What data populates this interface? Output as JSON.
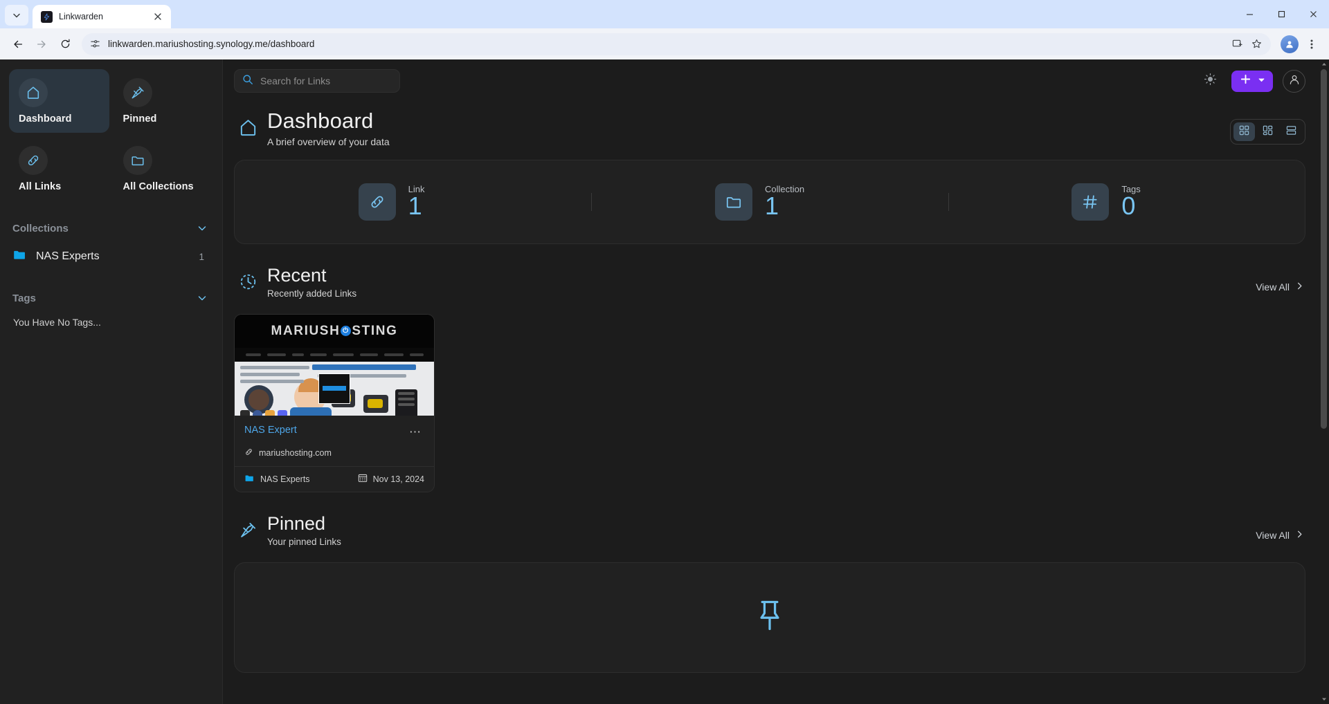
{
  "browser": {
    "tab": {
      "title": "Linkwarden",
      "favicon_icon": "linkwarden-bolt-icon",
      "close_icon": "close-icon"
    },
    "tab_list_icon": "chevron-down-icon",
    "window_controls": {
      "minimize": "minimize-icon",
      "maximize": "maximize-icon",
      "close": "close-icon"
    },
    "nav": {
      "back_icon": "back-arrow-icon",
      "forward_icon": "forward-arrow-icon",
      "reload_icon": "reload-icon"
    },
    "omnibox": {
      "url": "linkwarden.mariushosting.synology.me/dashboard",
      "site_settings_icon": "tune-site-settings-icon",
      "install_icon": "install-app-icon",
      "bookmark_icon": "star-bookmark-icon"
    },
    "profile_icon": "profile-avatar-icon",
    "menu_icon": "three-dot-menu-icon"
  },
  "sidebar": {
    "nav_tiles": [
      {
        "label": "Dashboard",
        "icon": "home-icon",
        "active": true
      },
      {
        "label": "Pinned",
        "icon": "pin-icon",
        "active": false
      },
      {
        "label": "All Links",
        "icon": "link-icon",
        "active": false
      },
      {
        "label": "All Collections",
        "icon": "folder-icon",
        "active": false
      }
    ],
    "collections": {
      "title": "Collections",
      "chevron_icon": "chevron-down-icon",
      "items": [
        {
          "name": "NAS Experts",
          "count": "1",
          "icon": "folder-filled-icon"
        }
      ]
    },
    "tags": {
      "title": "Tags",
      "chevron_icon": "chevron-down-icon",
      "empty_text": "You Have No Tags..."
    }
  },
  "topbar": {
    "search": {
      "placeholder": "Search for Links",
      "value": "",
      "icon": "search-icon"
    },
    "theme_toggle_icon": "sun-icon",
    "add_button": {
      "icon": "plus-icon",
      "chevron_icon": "chevron-down-icon"
    },
    "account_icon": "user-account-icon"
  },
  "page": {
    "icon": "home-icon",
    "title": "Dashboard",
    "subtitle": "A brief overview of your data",
    "view_modes": [
      {
        "name": "grid-view",
        "icon": "grid-view-icon",
        "active": true
      },
      {
        "name": "masonry-view",
        "icon": "masonry-view-icon",
        "active": false
      },
      {
        "name": "list-view",
        "icon": "list-view-icon",
        "active": false
      }
    ]
  },
  "stats": [
    {
      "label": "Link",
      "value": "1",
      "icon": "link-icon"
    },
    {
      "label": "Collection",
      "value": "1",
      "icon": "folder-icon"
    },
    {
      "label": "Tags",
      "value": "0",
      "icon": "hash-icon"
    }
  ],
  "recent": {
    "icon": "clock-icon",
    "title": "Recent",
    "subtitle": "Recently added Links",
    "view_all": {
      "label": "View All",
      "icon": "chevron-right-icon"
    },
    "cards": [
      {
        "title": "NAS Expert",
        "url": "mariushosting.com",
        "url_icon": "link-icon",
        "menu_icon": "three-dot-menu-icon",
        "collection": "NAS Experts",
        "collection_icon": "folder-filled-icon",
        "date": "Nov 13, 2024",
        "date_icon": "calendar-icon",
        "thumbnail": {
          "brand_left": "MARIUSH",
          "brand_power": "⏻",
          "brand_right": "STING"
        }
      }
    ]
  },
  "pinned": {
    "icon": "pin-icon",
    "title": "Pinned",
    "subtitle": "Your pinned Links",
    "view_all": {
      "label": "View All",
      "icon": "chevron-right-icon"
    },
    "empty_icon": "pin-large-icon"
  },
  "colors": {
    "accent_blue": "#79c5f2",
    "accent_purple": "#7a2ff2",
    "link_blue": "#4ea6e8",
    "sidebar_bg": "#212121",
    "page_bg": "#1c1c1c"
  }
}
